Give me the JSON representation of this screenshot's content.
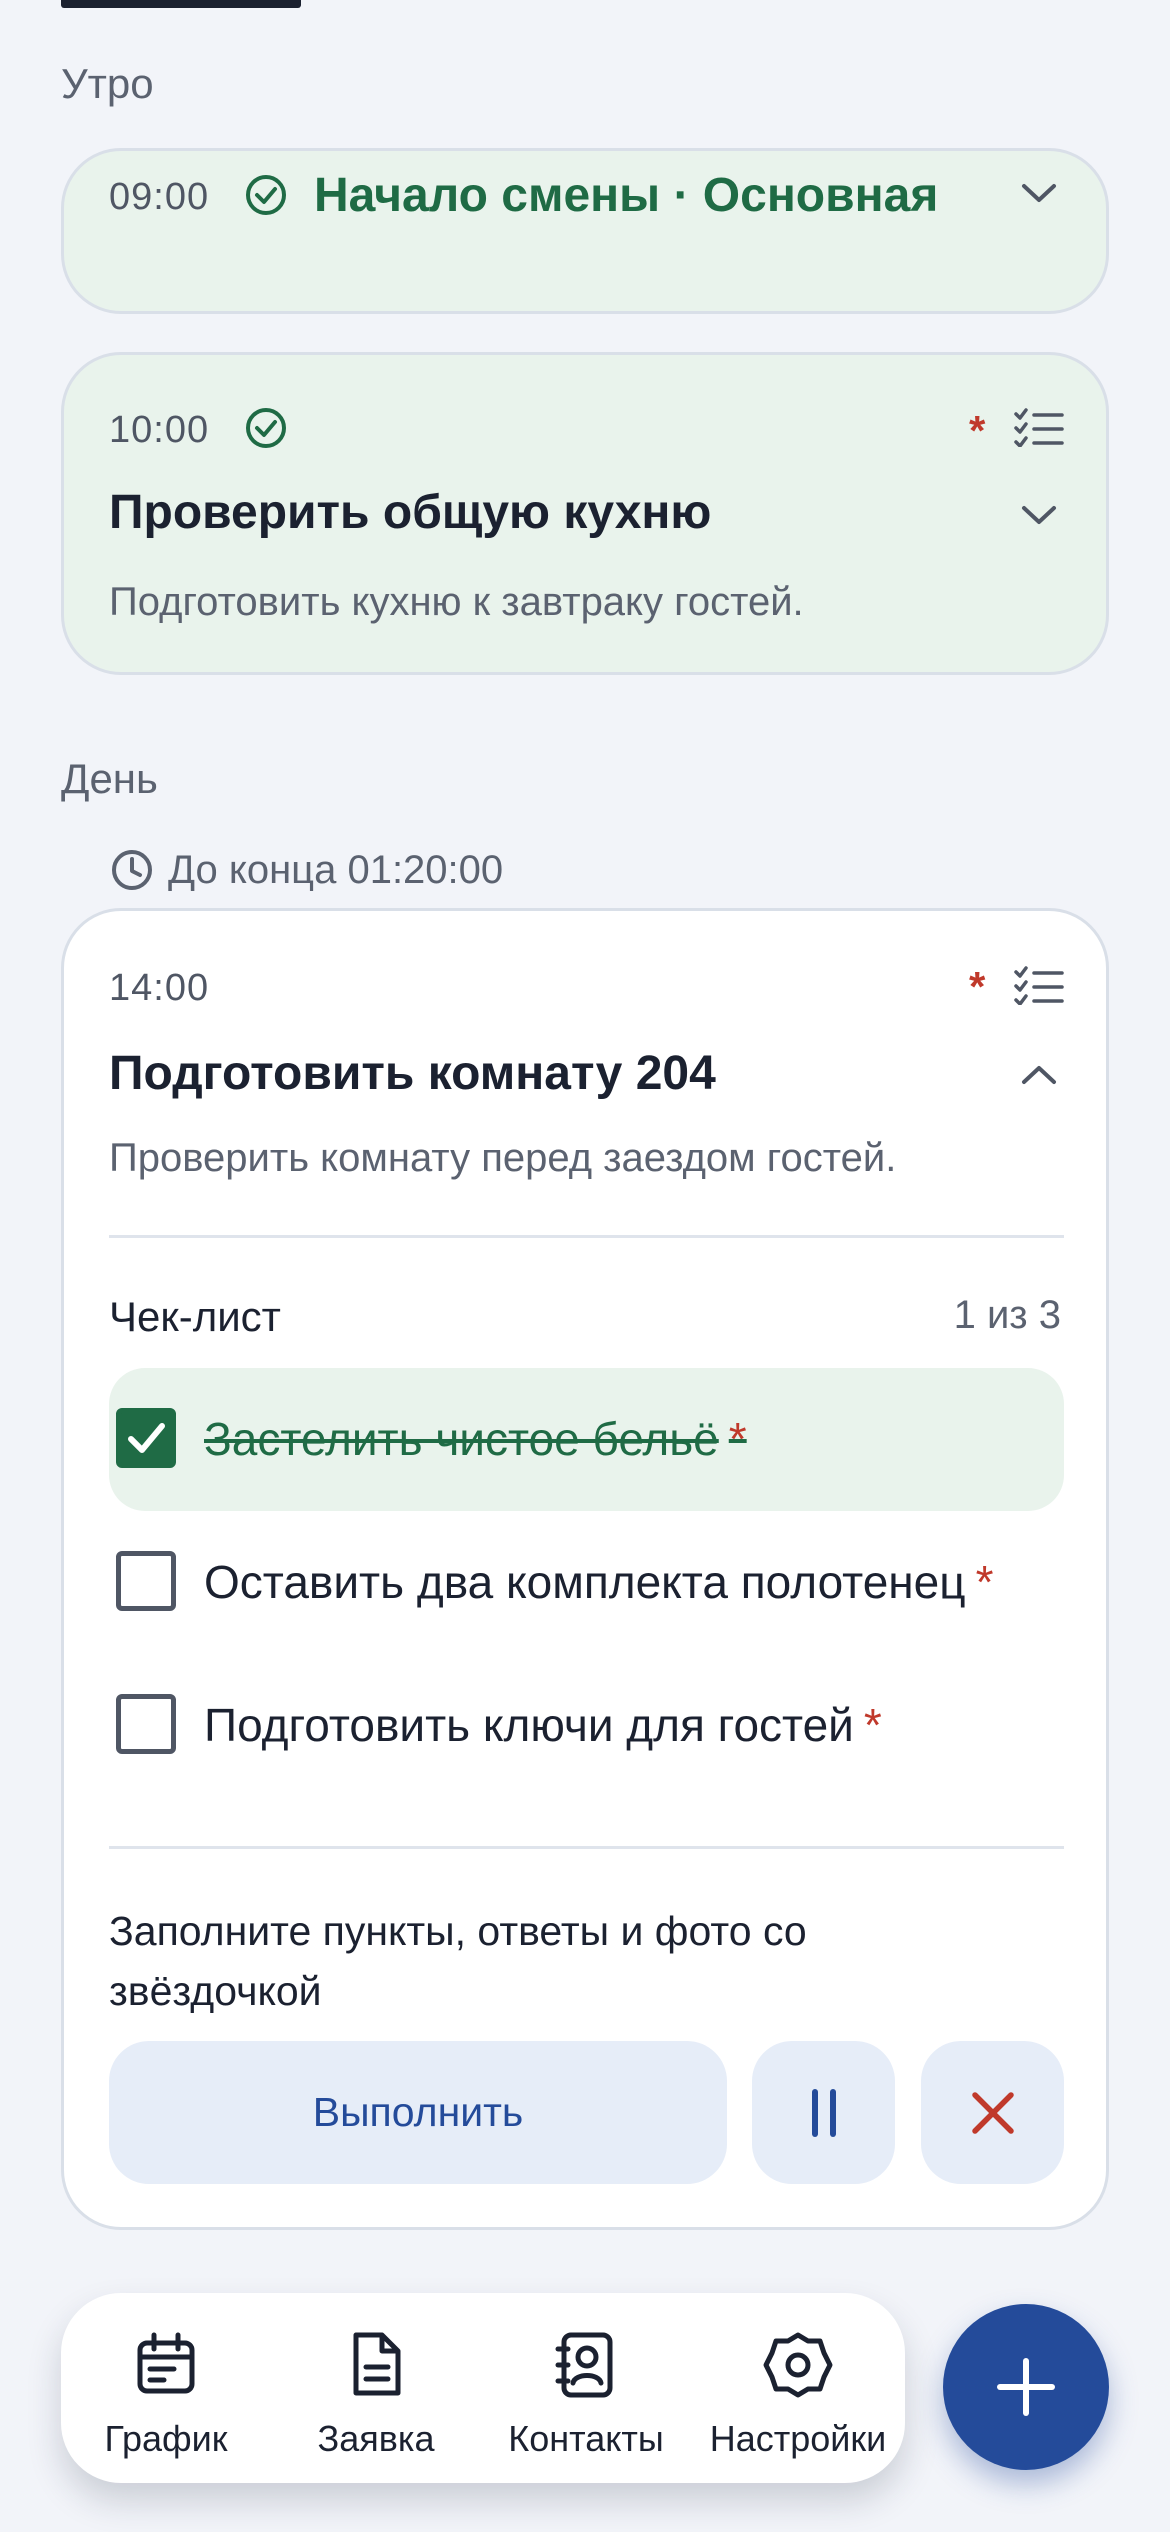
{
  "sections": {
    "morning": "Утро",
    "day": "День"
  },
  "task1": {
    "time": "09:00",
    "title": "Начало смены · Основная"
  },
  "task2": {
    "time": "10:00",
    "title": "Проверить общую кухню",
    "description": "Подготовить кухню к завтраку гостей.",
    "required_mark": "*"
  },
  "timer": {
    "label": "До конца 01:20:00"
  },
  "task3": {
    "time": "14:00",
    "title": "Подготовить комнату 204",
    "description": "Проверить комнату перед заездом гостей.",
    "required_mark": "*",
    "checklist": {
      "title": "Чек-лист",
      "progress": "1 из 3",
      "items": [
        {
          "label": "Застелить чистое бельё",
          "required": "*",
          "checked": true
        },
        {
          "label": "Оставить два комплекта полотенец",
          "required": "*",
          "checked": false
        },
        {
          "label": "Подготовить ключи для гостей",
          "required": "*",
          "checked": false
        }
      ]
    },
    "hint": "Заполните пункты, ответы и фото со звёздочкой",
    "complete_label": "Выполнить"
  },
  "nav": {
    "items": [
      {
        "label": "График",
        "icon": "calendar-icon"
      },
      {
        "label": "Заявка",
        "icon": "document-icon"
      },
      {
        "label": "Контакты",
        "icon": "contacts-icon"
      },
      {
        "label": "Настройки",
        "icon": "settings-icon"
      }
    ]
  },
  "fab_icon": "plus-icon",
  "colors": {
    "accent": "#244b9a",
    "done_green": "#1f6b45",
    "done_bg": "#e9f3ec",
    "required_red": "#c0392b"
  }
}
